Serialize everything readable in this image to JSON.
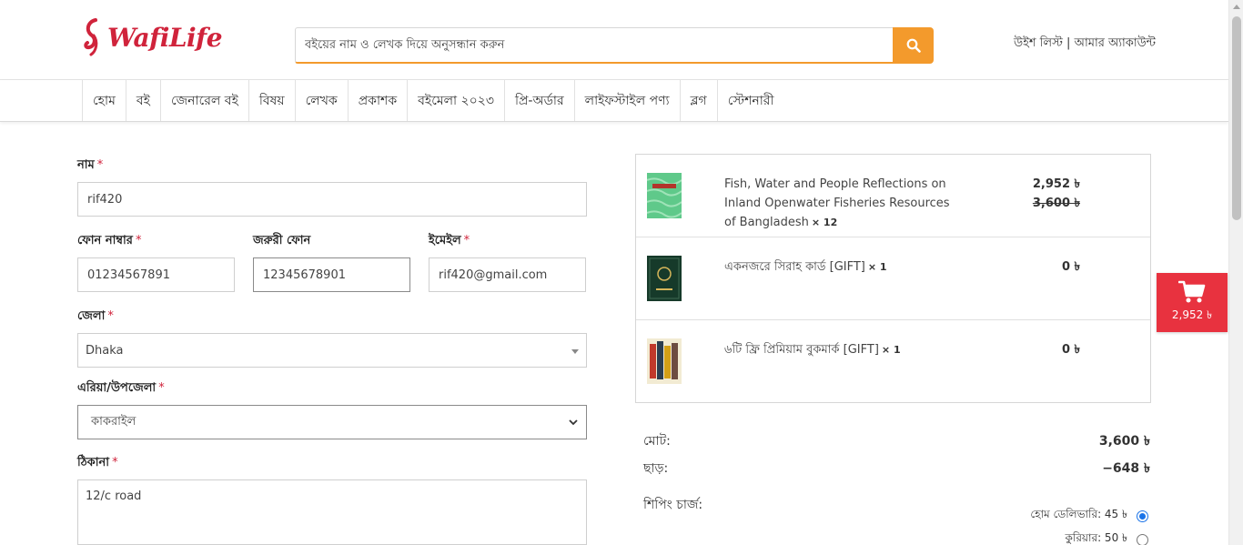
{
  "header": {
    "logo_text": "WafiLife",
    "search_placeholder": "বইয়ের নাম ও লেখক দিয়ে অনুসন্ধান করুন",
    "wishlist_link": "উইশ লিস্ট",
    "separator": " | ",
    "account_link": "আমার অ্যাকাউন্ট"
  },
  "nav": {
    "items": [
      "হোম",
      "বই",
      "জেনারেল বই",
      "বিষয়",
      "লেখক",
      "প্রকাশক",
      "বইমেলা ২০২৩",
      "প্রি-অর্ডার",
      "লাইফস্টাইল পণ্য",
      "ব্লগ",
      "স্টেশনারী"
    ]
  },
  "form": {
    "name_label": "নাম",
    "name_value": "rif420",
    "phone_label": "ফোন নাম্বার",
    "phone_value": "01234567891",
    "alt_phone_label": "জরুরী ফোন",
    "alt_phone_value": "12345678901",
    "email_label": "ইমেইল",
    "email_value": "rif420@gmail.com",
    "district_label": "জেলা",
    "district_value": "Dhaka",
    "area_label": "এরিয়া/উপজেলা",
    "area_value": "কাকরাইল",
    "address_label": "ঠিকানা",
    "address_value": "12/c road",
    "required_mark": "*"
  },
  "cart": {
    "items": [
      {
        "title": "Fish, Water and People Reflections on Inland Openwater Fisheries Resources of Bangladesh",
        "qty": "× 12",
        "price": "2,952 ৳",
        "old_price": "3,600 ৳"
      },
      {
        "title": "একনজরে সিরাহ কার্ড [GIFT]",
        "qty": "× 1",
        "price": "0 ৳"
      },
      {
        "title": "৬টি ফ্রি প্রিমিয়াম বুকমার্ক [GIFT]",
        "qty": "× 1",
        "price": "0 ৳"
      }
    ]
  },
  "summary": {
    "subtotal_label": "মোট:",
    "subtotal_value": "3,600 ৳",
    "discount_label": "ছাড়:",
    "discount_value": "−648 ৳",
    "shipping_label": "শিপিং চার্জ:",
    "shipping_options": [
      {
        "label": "হোম ডেলিভারি: 45 ৳",
        "selected": true
      },
      {
        "label": "কুরিয়ার: 50 ৳",
        "selected": false
      }
    ]
  },
  "floating_cart": {
    "total": "2,952 ৳"
  },
  "colors": {
    "brand_red": "#d0233b",
    "search_orange": "#f39a2c",
    "cart_red": "#e8323f",
    "radio_blue": "#1a73e8"
  }
}
